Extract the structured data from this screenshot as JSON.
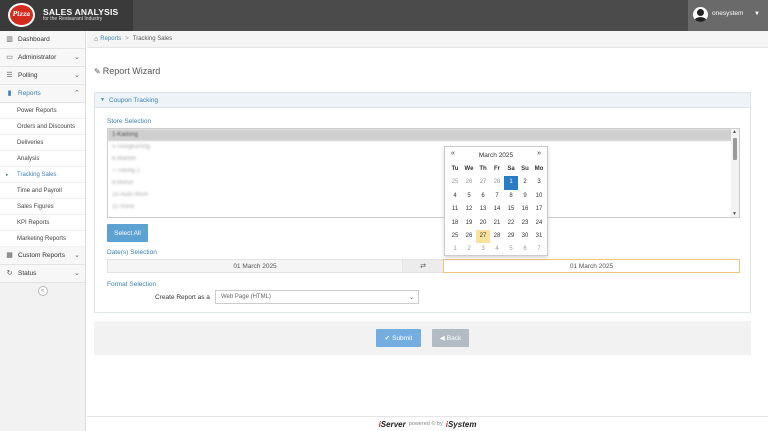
{
  "header": {
    "logo_text": "Pizza Hut",
    "title": "SALES ANALYSIS",
    "subtitle": "for the Restaurant Industry",
    "user_name": "onesystem"
  },
  "sidebar": {
    "items": [
      {
        "label": "Dashboard",
        "icon": "chart-icon"
      },
      {
        "label": "Administrator",
        "icon": "monitor-icon"
      },
      {
        "label": "Polling",
        "icon": "list-icon"
      },
      {
        "label": "Reports",
        "icon": "bar-chart-icon"
      }
    ],
    "report_items": [
      "Power Reports",
      "Orders and Discounts",
      "Deliveries",
      "Analysis",
      "Tracking Sales",
      "Time and Payroll",
      "Sales Figures",
      "KPI Reports",
      "Marketing Reports"
    ],
    "bottom_items": [
      {
        "label": "Custom Reports",
        "icon": "grid-icon"
      },
      {
        "label": "Status",
        "icon": "refresh-icon"
      }
    ],
    "collapse_symbol": "«"
  },
  "breadcrumb": {
    "reports": "Reports",
    "separator": ">",
    "current": "Tracking Sales"
  },
  "page": {
    "title": "Report Wizard"
  },
  "wizard": {
    "panel_title": "Coupon Tracking",
    "store_selection_label": "Store Selection",
    "stores": [
      "1-Kadong",
      "5-Songkurong",
      "6-Marten",
      "7-Tolong 1",
      "8-Bunut",
      "10-Auto Wish",
      "11-Sona"
    ],
    "select_all": "Select All",
    "dates_label": "Date(s) Selection",
    "date_from": "01 March 2025",
    "swap_symbol": "⇄",
    "date_to": "01 March 2025",
    "format_label": "Format Selection",
    "create_as_label": "Create Report as a",
    "format_value": "Web Page (HTML)"
  },
  "actions": {
    "submit": "Submit",
    "back": "Back"
  },
  "footer": {
    "left_brand": "Server",
    "powered": "powered © by",
    "right_brand": "System"
  },
  "calendar": {
    "month": "March 2025",
    "prev": "«",
    "next": "»",
    "days_of_week": [
      "Tu",
      "We",
      "Th",
      "Fr",
      "Sa",
      "Su",
      "Mo"
    ],
    "weeks": [
      [
        "25",
        "26",
        "27",
        "28",
        "1",
        "2",
        "3"
      ],
      [
        "4",
        "5",
        "6",
        "7",
        "8",
        "9",
        "10"
      ],
      [
        "11",
        "12",
        "13",
        "14",
        "15",
        "16",
        "17"
      ],
      [
        "18",
        "19",
        "20",
        "21",
        "22",
        "23",
        "24"
      ],
      [
        "25",
        "26",
        "27",
        "28",
        "29",
        "30",
        "31"
      ],
      [
        "1",
        "2",
        "3",
        "4",
        "5",
        "6",
        "7"
      ]
    ],
    "selected_day": "1",
    "today_day": "27"
  },
  "colors": {
    "accent": "#3c7fb1",
    "header_bg": "#4b4b4b",
    "brand_red": "#d52b1e",
    "selected_day": "#2a7cc3",
    "today_day": "#fbe29a"
  }
}
